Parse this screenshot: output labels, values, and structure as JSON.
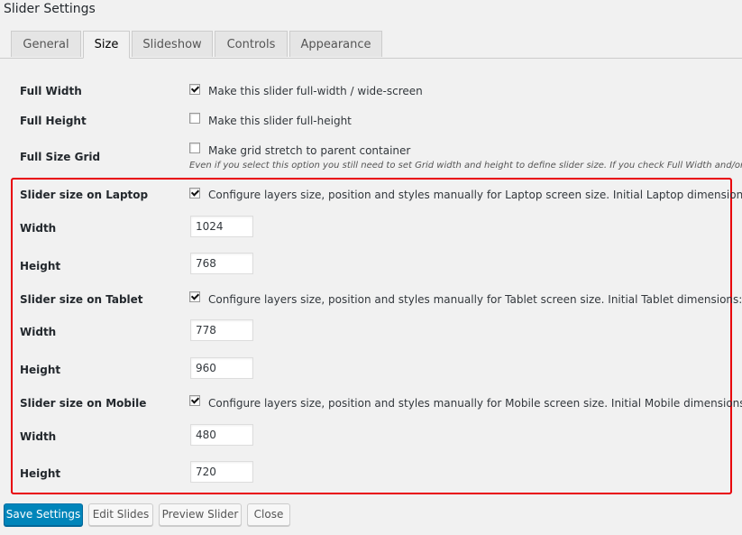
{
  "page": {
    "title": "Slider Settings"
  },
  "tabs": [
    {
      "label": "General",
      "active": false
    },
    {
      "label": "Size",
      "active": true
    },
    {
      "label": "Slideshow",
      "active": false
    },
    {
      "label": "Controls",
      "active": false
    },
    {
      "label": "Appearance",
      "active": false
    }
  ],
  "settings": {
    "full_width": {
      "label": "Full Width",
      "checkbox_text": "Make this slider full-width / wide-screen",
      "checked": true
    },
    "full_height": {
      "label": "Full Height",
      "checkbox_text": "Make this slider full-height",
      "checked": false
    },
    "full_size_grid": {
      "label": "Full Size Grid",
      "checkbox_text": "Make grid stretch to parent container",
      "checked": false,
      "hint": "Even if you select this option you still need to set Grid width and height to define slider size. If you check Full Width and/or F"
    },
    "laptop": {
      "label": "Slider size on Laptop",
      "checkbox_text": "Configure layers size, position and styles manually for Laptop screen size. Initial Laptop dimensions:",
      "checked": true,
      "width_label": "Width",
      "width_value": "1024",
      "height_label": "Height",
      "height_value": "768"
    },
    "tablet": {
      "label": "Slider size on Tablet",
      "checkbox_text": "Configure layers size, position and styles manually for Tablet screen size. Initial Tablet dimensions:",
      "checked": true,
      "width_label": "Width",
      "width_value": "778",
      "height_label": "Height",
      "height_value": "960"
    },
    "mobile": {
      "label": "Slider size on Mobile",
      "checkbox_text": "Configure layers size, position and styles manually for Mobile screen size. Initial Mobile dimensions:",
      "checked": true,
      "width_label": "Width",
      "width_value": "480",
      "height_label": "Height",
      "height_value": "720"
    }
  },
  "highlight_color": "#e8000b",
  "buttons": {
    "save": "Save Settings",
    "edit_slides": "Edit Slides",
    "preview": "Preview Slider",
    "close": "Close"
  }
}
